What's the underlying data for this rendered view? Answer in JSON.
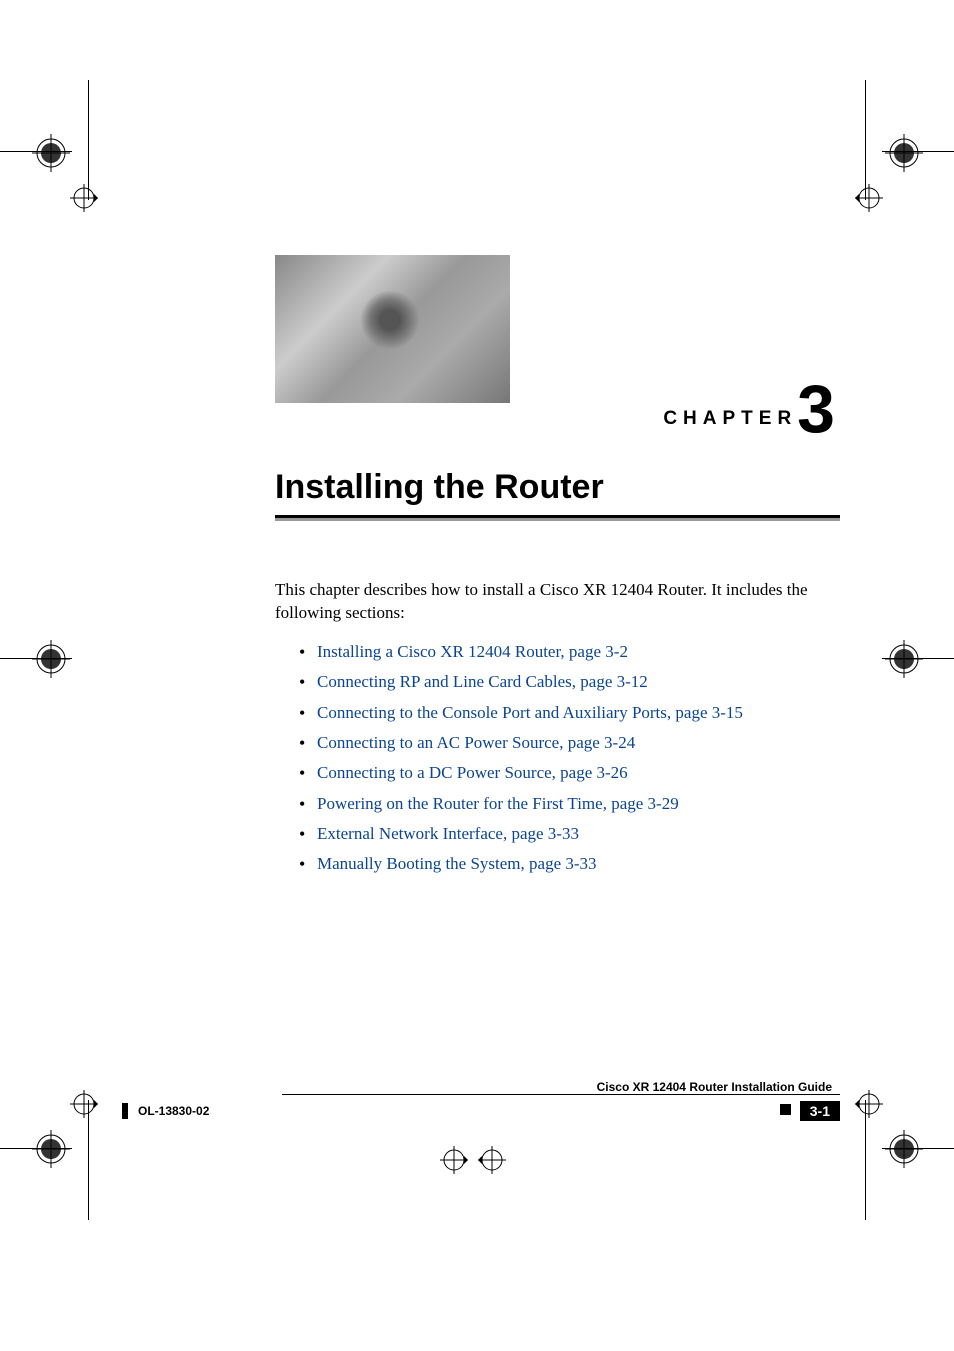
{
  "chapter": {
    "label": "CHAPTER",
    "number": "3",
    "title": "Installing the Router"
  },
  "intro": "This chapter describes how to install a Cisco XR 12404 Router. It includes the following sections:",
  "links": [
    "Installing a Cisco XR 12404 Router, page 3-2",
    "Connecting RP and Line Card Cables, page 3-12",
    "Connecting to the Console Port and Auxiliary Ports, page 3-15",
    "Connecting to an AC Power Source, page 3-24",
    "Connecting to a DC Power Source, page 3-26",
    "Powering on the Router for the First Time, page 3-29",
    "External Network Interface, page 3-33",
    "Manually Booting the System, page 3-33"
  ],
  "footer": {
    "guide_title": "Cisco XR 12404 Router Installation Guide",
    "doc_id": "OL-13830-02",
    "page_number": "3-1"
  }
}
